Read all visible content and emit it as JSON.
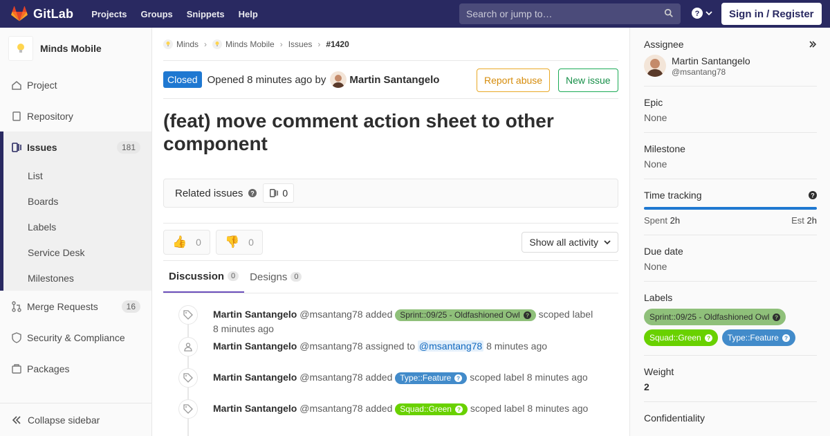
{
  "brand": {
    "name": "GitLab"
  },
  "topnav": {
    "links": [
      "Projects",
      "Groups",
      "Snippets",
      "Help"
    ],
    "search_placeholder": "Search or jump to…",
    "sign_in": "Sign in / Register"
  },
  "sidebar": {
    "project_name": "Minds Mobile",
    "items": [
      {
        "label": "Project",
        "icon": "home-icon"
      },
      {
        "label": "Repository",
        "icon": "doc-icon"
      },
      {
        "label": "Issues",
        "icon": "issues-icon",
        "count": "181"
      },
      {
        "label": "Merge Requests",
        "icon": "merge-icon",
        "count": "16"
      },
      {
        "label": "Security & Compliance",
        "icon": "shield-icon"
      },
      {
        "label": "Packages",
        "icon": "package-icon"
      }
    ],
    "sub_items": [
      "List",
      "Boards",
      "Labels",
      "Service Desk",
      "Milestones"
    ],
    "collapse": "Collapse sidebar"
  },
  "breadcrumb": [
    "Minds",
    "Minds Mobile",
    "Issues",
    "#1420"
  ],
  "issue": {
    "status": "Closed",
    "opened_text": "Opened 8 minutes ago by",
    "author": "Martin Santangelo",
    "report_abuse": "Report abuse",
    "new_issue": "New issue",
    "title": "(feat) move comment action sheet to other component",
    "related_title": "Related issues",
    "related_count": "0",
    "thumbs_up": "0",
    "thumbs_down": "0",
    "activity_filter": "Show all activity"
  },
  "tabs": [
    {
      "label": "Discussion",
      "count": "0"
    },
    {
      "label": "Designs",
      "count": "0"
    }
  ],
  "timeline": [
    {
      "author": "Martin Santangelo",
      "handle": "@msantang78",
      "action": "added",
      "label": "Sprint::09/25 - Oldfashioned Owl",
      "label_color": "#8fc07a",
      "label_text_color": "#2e2e2e",
      "suffix": "scoped label",
      "time": "8 minutes ago"
    },
    {
      "author": "Martin Santangelo",
      "handle": "@msantang78",
      "action": "assigned to",
      "mention": "@msantang78",
      "time": "8 minutes ago"
    },
    {
      "author": "Martin Santangelo",
      "handle": "@msantang78",
      "action": "added",
      "label": "Type::Feature",
      "label_color": "#428bca",
      "label_text_color": "#ffffff",
      "suffix": "scoped label",
      "time": "8 minutes ago"
    },
    {
      "author": "Martin Santangelo",
      "handle": "@msantang78",
      "action": "added",
      "label": "Squad::Green",
      "label_color": "#69d100",
      "label_text_color": "#ffffff",
      "suffix": "scoped label",
      "time": "8 minutes ago"
    }
  ],
  "right_sidebar": {
    "assignee_title": "Assignee",
    "assignee_name": "Martin Santangelo",
    "assignee_handle": "@msantang78",
    "epic_title": "Epic",
    "epic_value": "None",
    "milestone_title": "Milestone",
    "milestone_value": "None",
    "time_title": "Time tracking",
    "spent_label": "Spent",
    "spent_value": "2h",
    "est_label": "Est",
    "est_value": "2h",
    "time_progress": 1.0,
    "due_title": "Due date",
    "due_value": "None",
    "labels_title": "Labels",
    "labels": [
      {
        "text": "Sprint::09/25 - Oldfashioned Owl",
        "color": "#8fc07a",
        "text_color": "#2e2e2e"
      },
      {
        "text": "Squad::Green",
        "color": "#69d100",
        "text_color": "#ffffff"
      },
      {
        "text": "Type::Feature",
        "color": "#428bca",
        "text_color": "#ffffff"
      }
    ],
    "weight_title": "Weight",
    "weight_value": "2",
    "confidentiality_title": "Confidentiality"
  }
}
